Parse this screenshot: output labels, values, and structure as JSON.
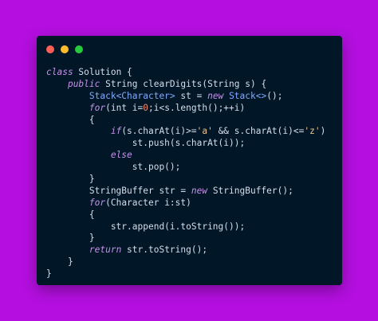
{
  "window": {
    "background": "#011627",
    "page_background": "#b40fe0",
    "controls": [
      {
        "name": "close",
        "color": "#ff5f56"
      },
      {
        "name": "minimize",
        "color": "#ffbd2e"
      },
      {
        "name": "maximize",
        "color": "#27c93f"
      }
    ]
  },
  "colors": {
    "keyword": "#c792ea",
    "type": "#82aaff",
    "plain": "#d6deeb",
    "number": "#f78c6c",
    "string": "#ecc48d"
  },
  "code": {
    "language": "java",
    "lines": [
      [
        {
          "t": "class",
          "c": "keyword"
        },
        {
          "t": " Solution {",
          "c": "plain"
        }
      ],
      [
        {
          "t": "    ",
          "c": "plain"
        },
        {
          "t": "public",
          "c": "keyword"
        },
        {
          "t": " String clearDigits(String s) {",
          "c": "plain"
        }
      ],
      [
        {
          "t": "        ",
          "c": "plain"
        },
        {
          "t": "Stack<Character>",
          "c": "type"
        },
        {
          "t": " st = ",
          "c": "plain"
        },
        {
          "t": "new",
          "c": "keyword"
        },
        {
          "t": " ",
          "c": "plain"
        },
        {
          "t": "Stack<>",
          "c": "type"
        },
        {
          "t": "();",
          "c": "plain"
        }
      ],
      [
        {
          "t": "        ",
          "c": "plain"
        },
        {
          "t": "for",
          "c": "keyword"
        },
        {
          "t": "(int i=",
          "c": "plain"
        },
        {
          "t": "0",
          "c": "number"
        },
        {
          "t": ";i<s.length();++i)",
          "c": "plain"
        }
      ],
      [
        {
          "t": "        {",
          "c": "plain"
        }
      ],
      [
        {
          "t": "            ",
          "c": "plain"
        },
        {
          "t": "if",
          "c": "keyword"
        },
        {
          "t": "(s.charAt(i)>=",
          "c": "plain"
        },
        {
          "t": "'a'",
          "c": "string"
        },
        {
          "t": " && s.charAt(i)<=",
          "c": "plain"
        },
        {
          "t": "'z'",
          "c": "string"
        },
        {
          "t": ")",
          "c": "plain"
        }
      ],
      [
        {
          "t": "                st.push(s.charAt(i));",
          "c": "plain"
        }
      ],
      [
        {
          "t": "            ",
          "c": "plain"
        },
        {
          "t": "else",
          "c": "keyword"
        }
      ],
      [
        {
          "t": "                st.pop();",
          "c": "plain"
        }
      ],
      [
        {
          "t": "        }",
          "c": "plain"
        }
      ],
      [
        {
          "t": "        StringBuffer str = ",
          "c": "plain"
        },
        {
          "t": "new",
          "c": "keyword"
        },
        {
          "t": " StringBuffer();",
          "c": "plain"
        }
      ],
      [
        {
          "t": "        ",
          "c": "plain"
        },
        {
          "t": "for",
          "c": "keyword"
        },
        {
          "t": "(Character i:st)",
          "c": "plain"
        }
      ],
      [
        {
          "t": "        {",
          "c": "plain"
        }
      ],
      [
        {
          "t": "            str.append(i.toString());",
          "c": "plain"
        }
      ],
      [
        {
          "t": "        }",
          "c": "plain"
        }
      ],
      [
        {
          "t": "        ",
          "c": "plain"
        },
        {
          "t": "return",
          "c": "keyword"
        },
        {
          "t": " str.toString();",
          "c": "plain"
        }
      ],
      [
        {
          "t": "    }",
          "c": "plain"
        }
      ],
      [
        {
          "t": "}",
          "c": "plain"
        }
      ]
    ]
  }
}
